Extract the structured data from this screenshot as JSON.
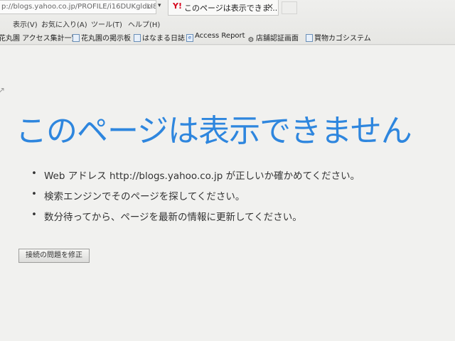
{
  "browser": {
    "address": "p://blogs.yahoo.co.jp/PROFILE/i16DUKgldLI8v",
    "tab": {
      "icon": "Y!",
      "label": "このページは表示できま...",
      "close": "×"
    },
    "menu": [
      "表示(V)",
      "お気に入り(A)",
      "ツール(T)",
      "ヘルプ(H)"
    ],
    "favorites": [
      {
        "label": "花丸園 アクセス集計一覧",
        "icon": "none"
      },
      {
        "label": "花丸園の掲示板",
        "icon": "page-icon"
      },
      {
        "label": "はなまる日誌",
        "icon": "page-icon"
      },
      {
        "label": "Access Report",
        "icon": "ie-icon"
      },
      {
        "label": "店舗認証画面",
        "icon": "gear-icon"
      },
      {
        "label": "買物カゴシステム",
        "icon": "page-icon"
      }
    ]
  },
  "error_page": {
    "title": "このページは表示できません",
    "tips": [
      "Web アドレス http://blogs.yahoo.co.jp が正しいか確かめてください。",
      "検索エンジンでそのページを探してください。",
      "数分待ってから、ページを最新の情報に更新してください。"
    ],
    "fix_button": "接続の問題を修正"
  },
  "colors": {
    "title": "#2e86de",
    "tab_icon": "#d6001c",
    "background": "#f1f1ef"
  }
}
